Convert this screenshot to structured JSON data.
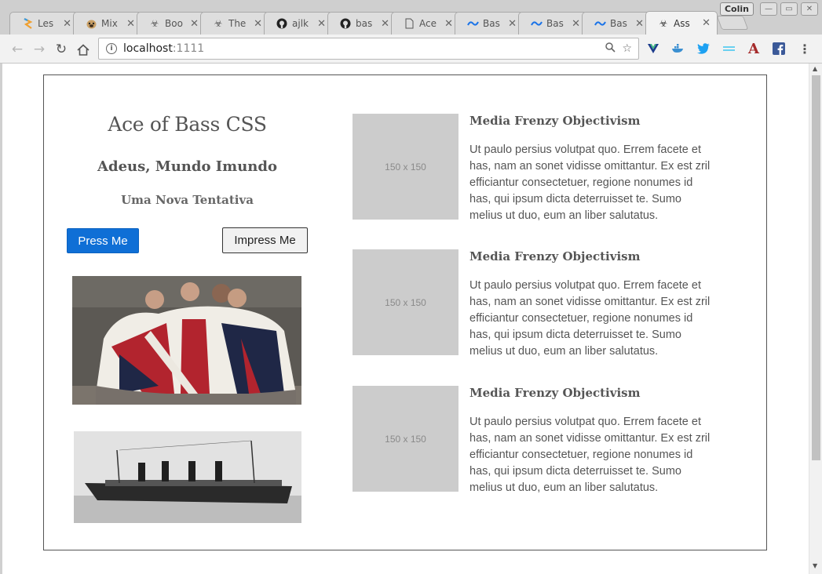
{
  "browser": {
    "tabs": [
      {
        "label": "Les",
        "icon": "stack-icon",
        "active": false
      },
      {
        "label": "Mix",
        "icon": "pug-icon",
        "active": false
      },
      {
        "label": "Boo",
        "icon": "biohazard-icon",
        "active": false
      },
      {
        "label": "The",
        "icon": "biohazard-icon",
        "active": false
      },
      {
        "label": "ajlk",
        "icon": "github-icon",
        "active": false
      },
      {
        "label": "bas",
        "icon": "github-icon",
        "active": false
      },
      {
        "label": "Ace",
        "icon": "document-icon",
        "active": false
      },
      {
        "label": "Bas",
        "icon": "wave-icon",
        "active": false
      },
      {
        "label": "Bas",
        "icon": "wave-icon",
        "active": false
      },
      {
        "label": "Bas",
        "icon": "wave-icon",
        "active": false
      },
      {
        "label": "Ass",
        "icon": "biohazard-icon",
        "active": true
      }
    ],
    "profile_name": "Colin",
    "address": {
      "host": "localhost",
      "port": ":1111"
    }
  },
  "page": {
    "title": "Ace of Bass CSS",
    "subtitle": "Adeus, Mundo Imundo",
    "tagline": "Uma Nova Tentativa",
    "primary_button": "Press Me",
    "secondary_button": "Impress Me",
    "media_items": [
      {
        "placeholder": "150 x 150",
        "heading": "Media Frenzy Objectivism",
        "text": "Ut paulo persius volutpat quo. Errem facete et has, nam an sonet vidisse omittantur. Ex est zril efficiantur consectetuer, regione nonumes id has, qui ipsum dicta deterruisset te. Sumo melius ut duo, eum an liber salutatus."
      },
      {
        "placeholder": "150 x 150",
        "heading": "Media Frenzy Objectivism",
        "text": "Ut paulo persius volutpat quo. Errem facete et has, nam an sonet vidisse omittantur. Ex est zril efficiantur consectetuer, regione nonumes id has, qui ipsum dicta deterruisset te. Sumo melius ut duo, eum an liber salutatus."
      },
      {
        "placeholder": "150 x 150",
        "heading": "Media Frenzy Objectivism",
        "text": "Ut paulo persius volutpat quo. Errem facete et has, nam an sonet vidisse omittantur. Ex est zril efficiantur consectetuer, regione nonumes id has, qui ipsum dicta deterruisset te. Sumo melius ut duo, eum an liber salutatus."
      }
    ]
  },
  "colors": {
    "primary_button": "#0f6fd6",
    "placeholder_gray": "#cccccc",
    "text_gray": "#555555"
  }
}
